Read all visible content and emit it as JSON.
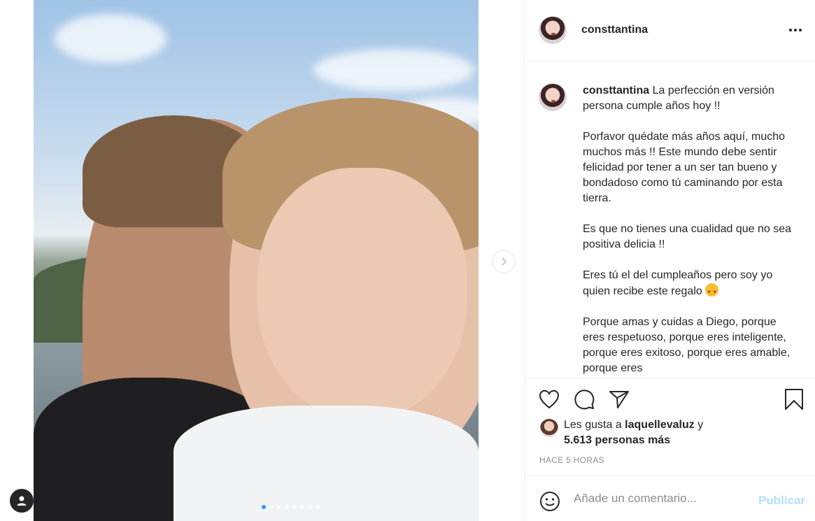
{
  "post": {
    "username": "consttantina",
    "more_icon": "more-horizontal-icon",
    "carousel": {
      "count": 8,
      "active": 0
    }
  },
  "caption": {
    "username": "consttantina",
    "text": " La perfección en versión persona cumple años hoy !!\n\nPorfavor quédate más años aquí, mucho muchos más !! Este mundo debe sentir felicidad por tener a un ser tan bueno y bondadoso como tú caminando por esta tierra.\n\nEs que no tienes una cualidad que no sea positiva delicia !!\n\nEres tú el del cumpleaños pero soy yo quien recibe este regalo ",
    "text_after": "\n\nPorque amas y cuidas a Diego, porque eres respetuoso, porque eres inteligente, porque eres exitoso, porque eres amable, porque eres"
  },
  "likes": {
    "prefix": "Les gusta a ",
    "user": "laquellevaluz",
    "suffix": " y",
    "others": "5.613 personas más"
  },
  "time_label": "HACE 5 HORAS",
  "comment": {
    "placeholder": "Añade un comentario...",
    "publish_label": "Publicar"
  },
  "colors": {
    "accent": "#3897f0",
    "publish_disabled": "#b2dffc",
    "muted": "#8e8e8e"
  }
}
